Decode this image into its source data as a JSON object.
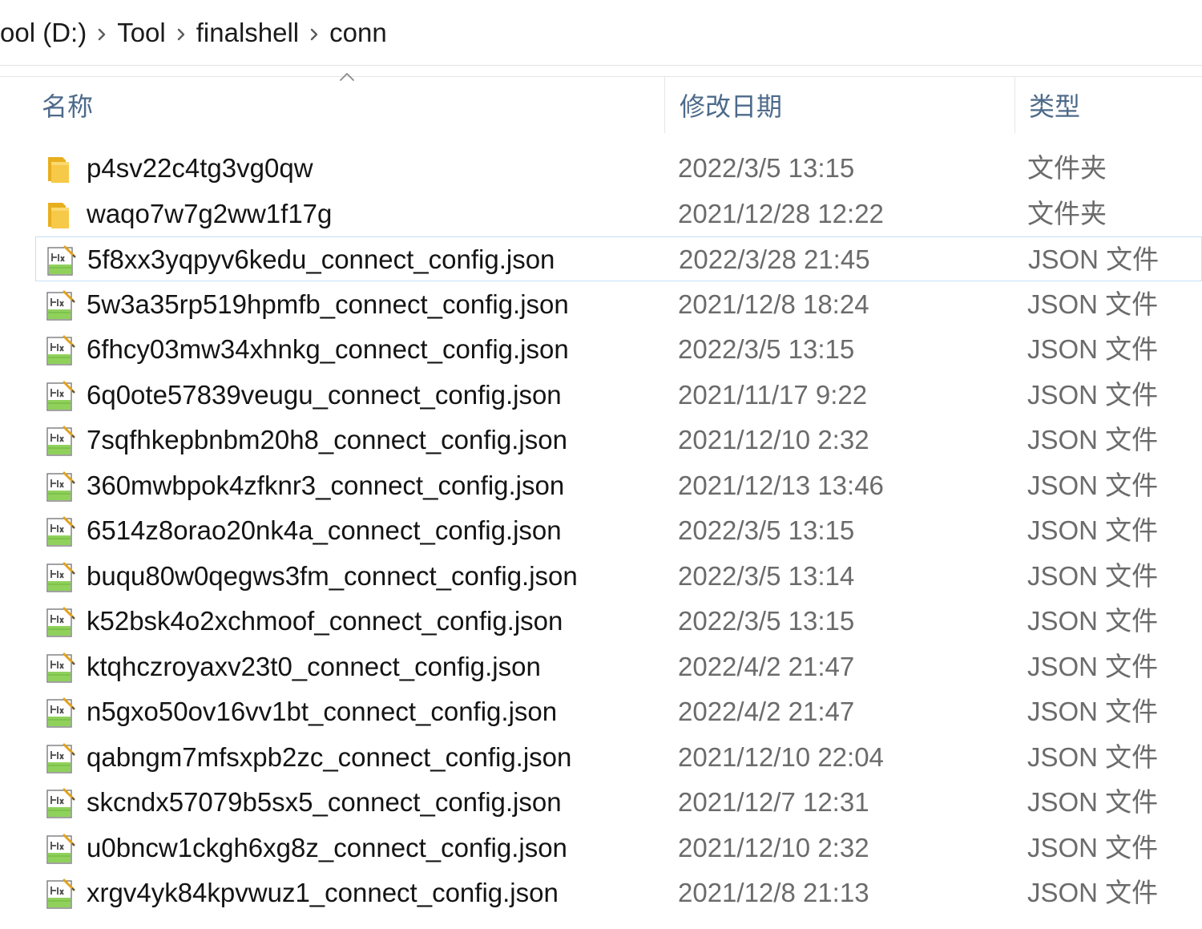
{
  "breadcrumb": {
    "items": [
      "ool (D:)",
      "Tool",
      "finalshell",
      "conn"
    ]
  },
  "header": {
    "name": "名称",
    "date": "修改日期",
    "type": "类型"
  },
  "colors": {
    "header_text": "#4d6a8a",
    "hover_border": "#c7dff5",
    "folder": "#f4c542",
    "json_icon": "#6cc24a"
  },
  "files": [
    {
      "name": "p4sv22c4tg3vg0qw",
      "date": "2022/3/5 13:15",
      "type": "文件夹",
      "icon": "folder-icon"
    },
    {
      "name": "waqo7w7g2ww1f17g",
      "date": "2021/12/28 12:22",
      "type": "文件夹",
      "icon": "folder-icon"
    },
    {
      "name": "5f8xx3yqpyv6kedu_connect_config.json",
      "date": "2022/3/28 21:45",
      "type": "JSON 文件",
      "icon": "json-file-icon"
    },
    {
      "name": "5w3a35rp519hpmfb_connect_config.json",
      "date": "2021/12/8 18:24",
      "type": "JSON 文件",
      "icon": "json-file-icon"
    },
    {
      "name": "6fhcy03mw34xhnkg_connect_config.json",
      "date": "2022/3/5 13:15",
      "type": "JSON 文件",
      "icon": "json-file-icon"
    },
    {
      "name": "6q0ote57839veugu_connect_config.json",
      "date": "2021/11/17 9:22",
      "type": "JSON 文件",
      "icon": "json-file-icon"
    },
    {
      "name": "7sqfhkepbnbm20h8_connect_config.json",
      "date": "2021/12/10 2:32",
      "type": "JSON 文件",
      "icon": "json-file-icon"
    },
    {
      "name": "360mwbpok4zfknr3_connect_config.json",
      "date": "2021/12/13 13:46",
      "type": "JSON 文件",
      "icon": "json-file-icon"
    },
    {
      "name": "6514z8orao20nk4a_connect_config.json",
      "date": "2022/3/5 13:15",
      "type": "JSON 文件",
      "icon": "json-file-icon"
    },
    {
      "name": "buqu80w0qegws3fm_connect_config.json",
      "date": "2022/3/5 13:14",
      "type": "JSON 文件",
      "icon": "json-file-icon"
    },
    {
      "name": "k52bsk4o2xchmoof_connect_config.json",
      "date": "2022/3/5 13:15",
      "type": "JSON 文件",
      "icon": "json-file-icon"
    },
    {
      "name": "ktqhczroyaxv23t0_connect_config.json",
      "date": "2022/4/2 21:47",
      "type": "JSON 文件",
      "icon": "json-file-icon"
    },
    {
      "name": "n5gxo50ov16vv1bt_connect_config.json",
      "date": "2022/4/2 21:47",
      "type": "JSON 文件",
      "icon": "json-file-icon"
    },
    {
      "name": "qabngm7mfsxpb2zc_connect_config.json",
      "date": "2021/12/10 22:04",
      "type": "JSON 文件",
      "icon": "json-file-icon"
    },
    {
      "name": "skcndx57079b5sx5_connect_config.json",
      "date": "2021/12/7 12:31",
      "type": "JSON 文件",
      "icon": "json-file-icon"
    },
    {
      "name": "u0bncw1ckgh6xg8z_connect_config.json",
      "date": "2021/12/10 2:32",
      "type": "JSON 文件",
      "icon": "json-file-icon"
    },
    {
      "name": "xrgv4yk84kpvwuz1_connect_config.json",
      "date": "2021/12/8 21:13",
      "type": "JSON 文件",
      "icon": "json-file-icon"
    }
  ]
}
